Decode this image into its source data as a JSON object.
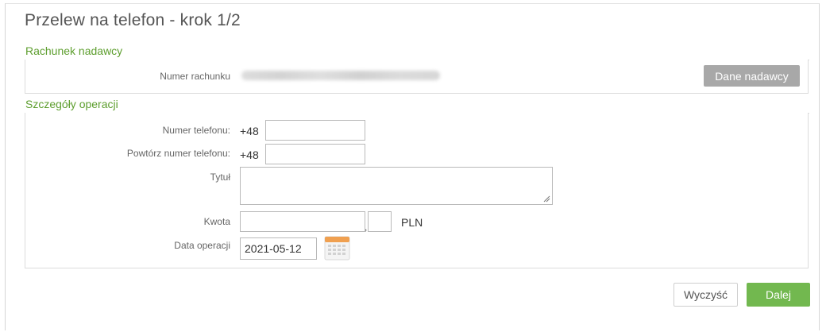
{
  "page": {
    "title": "Przelew na telefon - krok 1/2"
  },
  "sender": {
    "section_label": "Rachunek nadawcy",
    "account_label": "Numer rachunku",
    "details_button": "Dane nadawcy"
  },
  "details": {
    "section_label": "Szczegóły operacji",
    "phone_label": "Numer telefonu:",
    "phone_prefix": "+48",
    "phone_value": "",
    "repeat_phone_label": "Powtórz numer telefonu:",
    "repeat_phone_prefix": "+48",
    "repeat_phone_value": "",
    "title_label": "Tytuł",
    "title_value": "",
    "amount_label": "Kwota",
    "amount_value": "",
    "amount_separator": ",",
    "amount_cents_value": "",
    "currency": "PLN",
    "date_label": "Data operacji",
    "date_value": "2021-05-12"
  },
  "actions": {
    "clear_button": "Wyczyść",
    "next_button": "Dalej"
  },
  "colors": {
    "accent_green": "#72b84f",
    "section_green": "#5d9e2e",
    "grey_button": "#a8a8a8",
    "calendar_orange": "#f0a050"
  },
  "icons": {
    "calendar": "calendar-icon",
    "resize": "resize-grip-icon"
  }
}
